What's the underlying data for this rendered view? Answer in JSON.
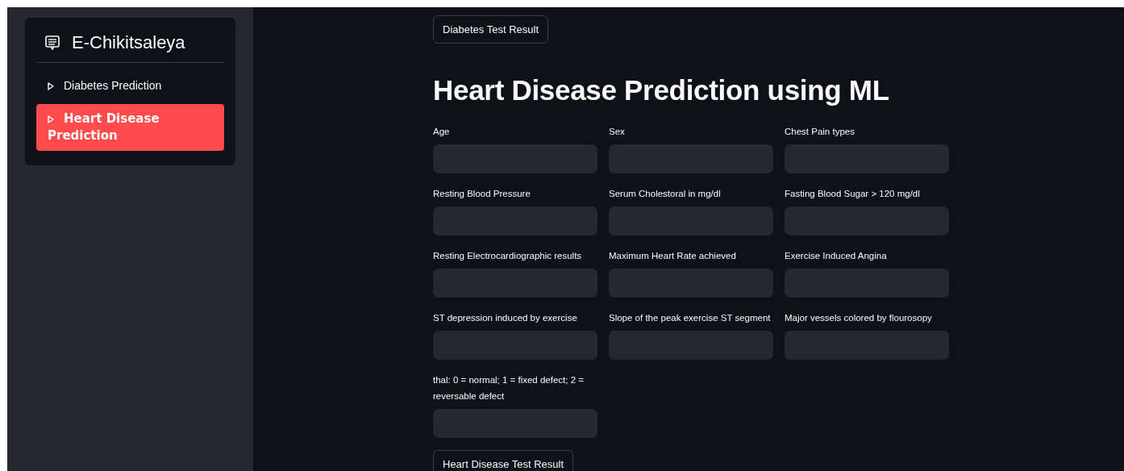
{
  "sidebar": {
    "title": "E-Chikitsaleya",
    "items": [
      {
        "label": "Diabetes Prediction",
        "selected": false
      },
      {
        "label": "Heart Disease Prediction",
        "selected": true
      }
    ]
  },
  "top_button": "Diabetes Test Result",
  "heading": "Heart Disease Prediction using ML",
  "fields": [
    {
      "label": "Age"
    },
    {
      "label": "Sex"
    },
    {
      "label": "Chest Pain types"
    },
    {
      "label": "Resting Blood Pressure"
    },
    {
      "label": "Serum Cholestoral in mg/dl"
    },
    {
      "label": "Fasting Blood Sugar > 120 mg/dl"
    },
    {
      "label": "Resting Electrocardiographic results"
    },
    {
      "label": "Maximum Heart Rate achieved"
    },
    {
      "label": "Exercise Induced Angina"
    },
    {
      "label": "ST depression induced by exercise"
    },
    {
      "label": "Slope of the peak exercise ST segment"
    },
    {
      "label": "Major vessels colored by flourosopy"
    },
    {
      "label": "thal: 0 = normal; 1 = fixed defect; 2 = reversable defect"
    }
  ],
  "submit_button": "Heart Disease Test Result"
}
